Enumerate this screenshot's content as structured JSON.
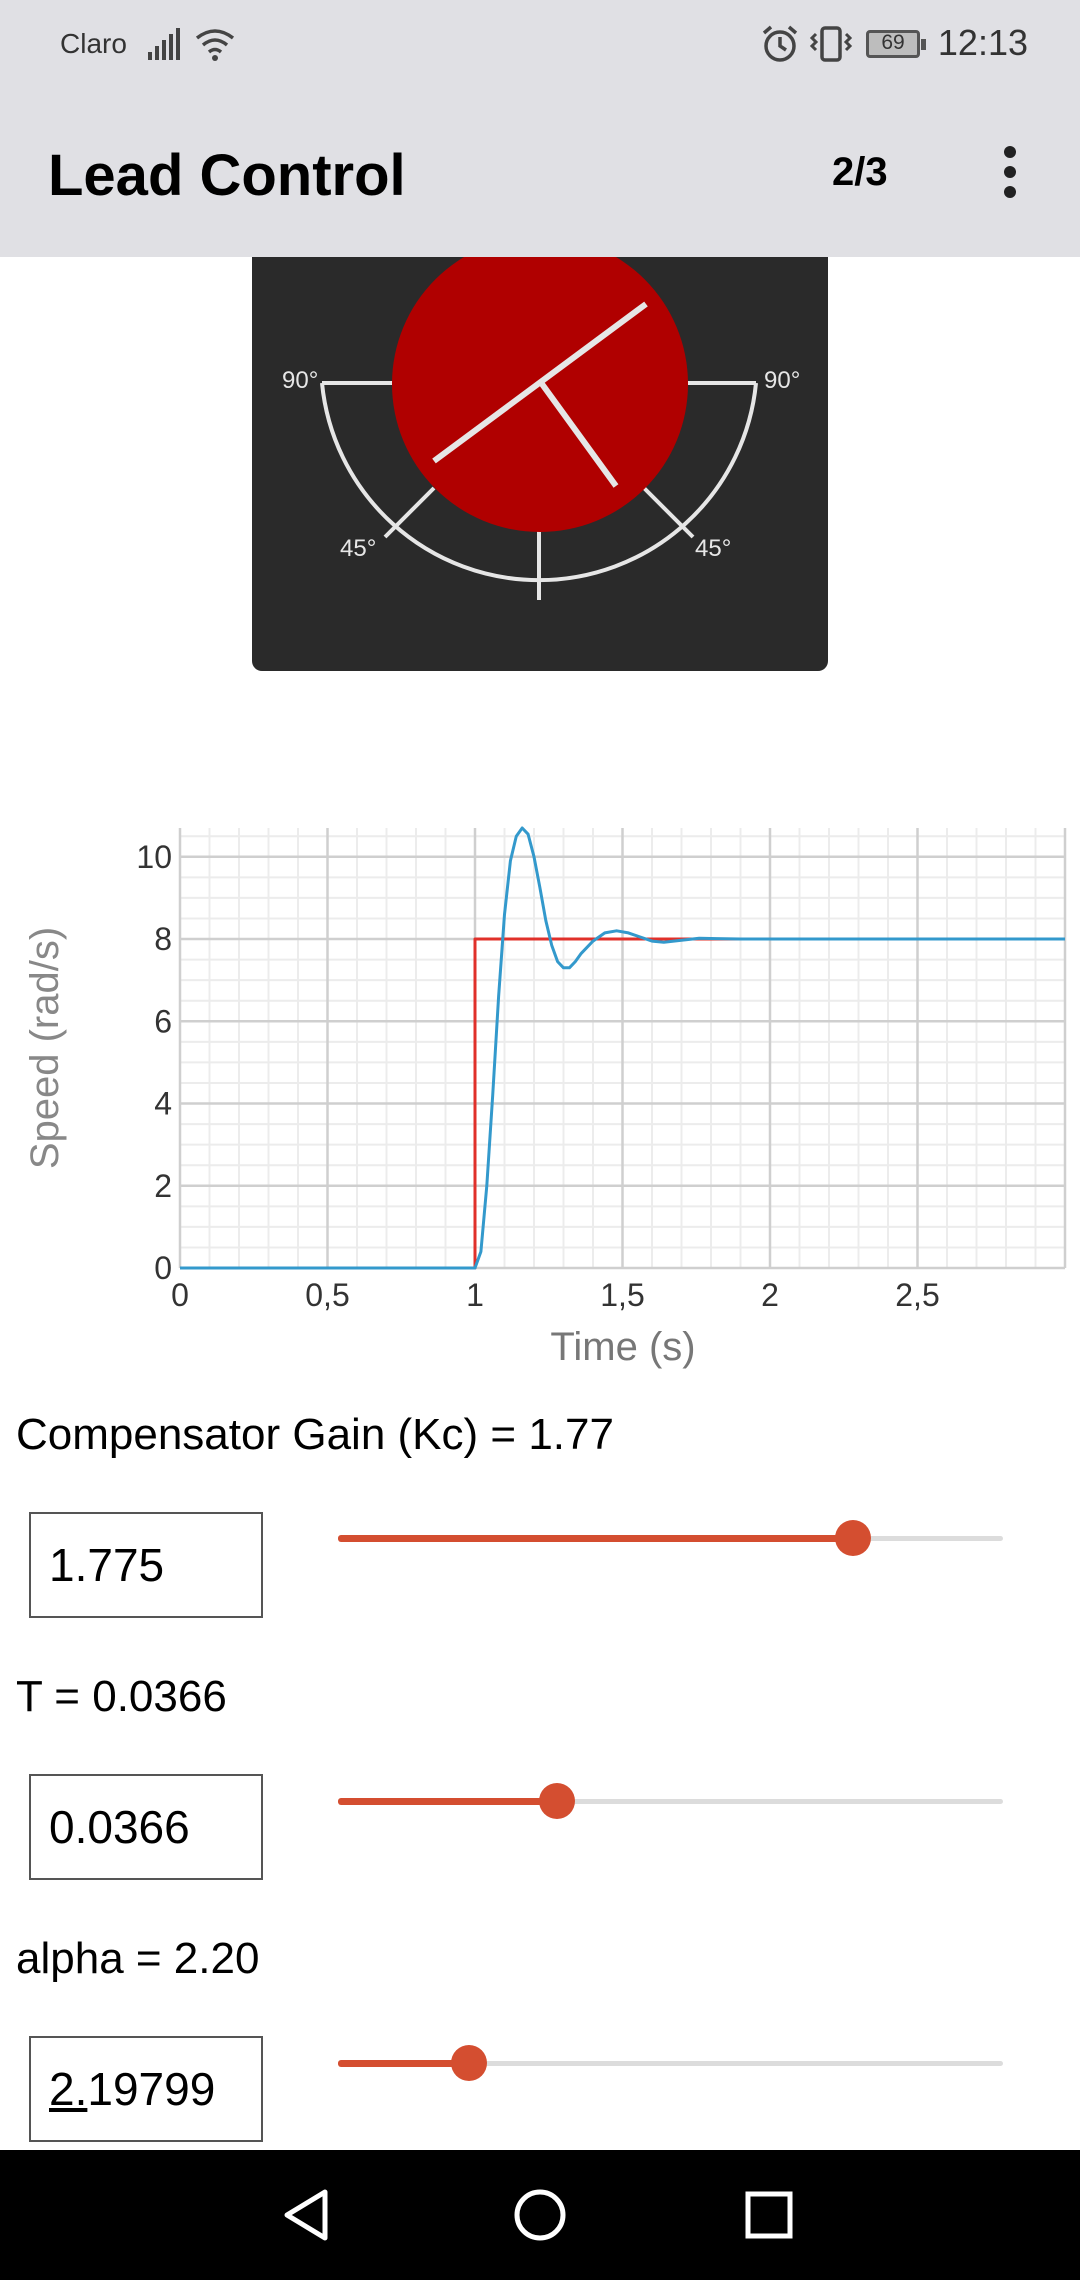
{
  "status_bar": {
    "carrier": "Claro",
    "battery": "69",
    "time": "12:13"
  },
  "app_bar": {
    "title": "Lead Control",
    "page_indicator": "2/3",
    "menu_icon": "more-vert-icon"
  },
  "dial": {
    "labels": {
      "left_top": "90°",
      "right_top": "90°",
      "left_mid": "45°",
      "right_mid": "45°"
    },
    "colors": {
      "panel": "#2a2a2a",
      "disc": "#b00000",
      "lines": "#e6e6e6"
    }
  },
  "chart_data": {
    "type": "line",
    "xlabel": "Time (s)",
    "ylabel": "Speed (rad/s)",
    "xlim": [
      0,
      3
    ],
    "ylim": [
      0,
      10.7
    ],
    "x_ticks": [
      "0",
      "0,5",
      "1",
      "1,5",
      "2",
      "2,5"
    ],
    "y_ticks": [
      "0",
      "2",
      "4",
      "6",
      "8",
      "10"
    ],
    "grid": true,
    "series": [
      {
        "color": "#e0302a",
        "points": [
          [
            0,
            0
          ],
          [
            1.0,
            0
          ],
          [
            1.0,
            8
          ],
          [
            3.0,
            8
          ]
        ]
      },
      {
        "color": "#3399cc",
        "points": [
          [
            0,
            0
          ],
          [
            1.0,
            0
          ],
          [
            1.02,
            0.4
          ],
          [
            1.04,
            2.0
          ],
          [
            1.06,
            4.2
          ],
          [
            1.08,
            6.6
          ],
          [
            1.1,
            8.6
          ],
          [
            1.12,
            9.9
          ],
          [
            1.14,
            10.5
          ],
          [
            1.16,
            10.7
          ],
          [
            1.18,
            10.55
          ],
          [
            1.2,
            10.0
          ],
          [
            1.22,
            9.25
          ],
          [
            1.24,
            8.45
          ],
          [
            1.26,
            7.85
          ],
          [
            1.28,
            7.45
          ],
          [
            1.3,
            7.3
          ],
          [
            1.32,
            7.3
          ],
          [
            1.34,
            7.45
          ],
          [
            1.36,
            7.65
          ],
          [
            1.4,
            7.95
          ],
          [
            1.44,
            8.15
          ],
          [
            1.48,
            8.2
          ],
          [
            1.52,
            8.15
          ],
          [
            1.56,
            8.05
          ],
          [
            1.6,
            7.95
          ],
          [
            1.64,
            7.92
          ],
          [
            1.7,
            7.97
          ],
          [
            1.76,
            8.02
          ],
          [
            1.82,
            8.01
          ],
          [
            1.9,
            8.0
          ],
          [
            2.0,
            8.0
          ],
          [
            3.0,
            8.0
          ]
        ]
      }
    ]
  },
  "params": [
    {
      "label": "Compensator Gain (Kc) = 1.77",
      "value_prefix": "",
      "value_rest": "1.775",
      "fraction": 0.775
    },
    {
      "label": "T = 0.0366",
      "value_prefix": "",
      "value_rest": "0.0366",
      "fraction": 0.33
    },
    {
      "label": "alpha = 2.20",
      "value_prefix": "2.",
      "value_rest": "19799",
      "fraction": 0.197
    }
  ],
  "nav_bar": {
    "back_icon": "back-triangle-icon",
    "home_icon": "home-circle-icon",
    "recents_icon": "recents-square-icon"
  },
  "colors": {
    "accent": "#d44e30",
    "bar_bg": "#e0e0e4"
  }
}
